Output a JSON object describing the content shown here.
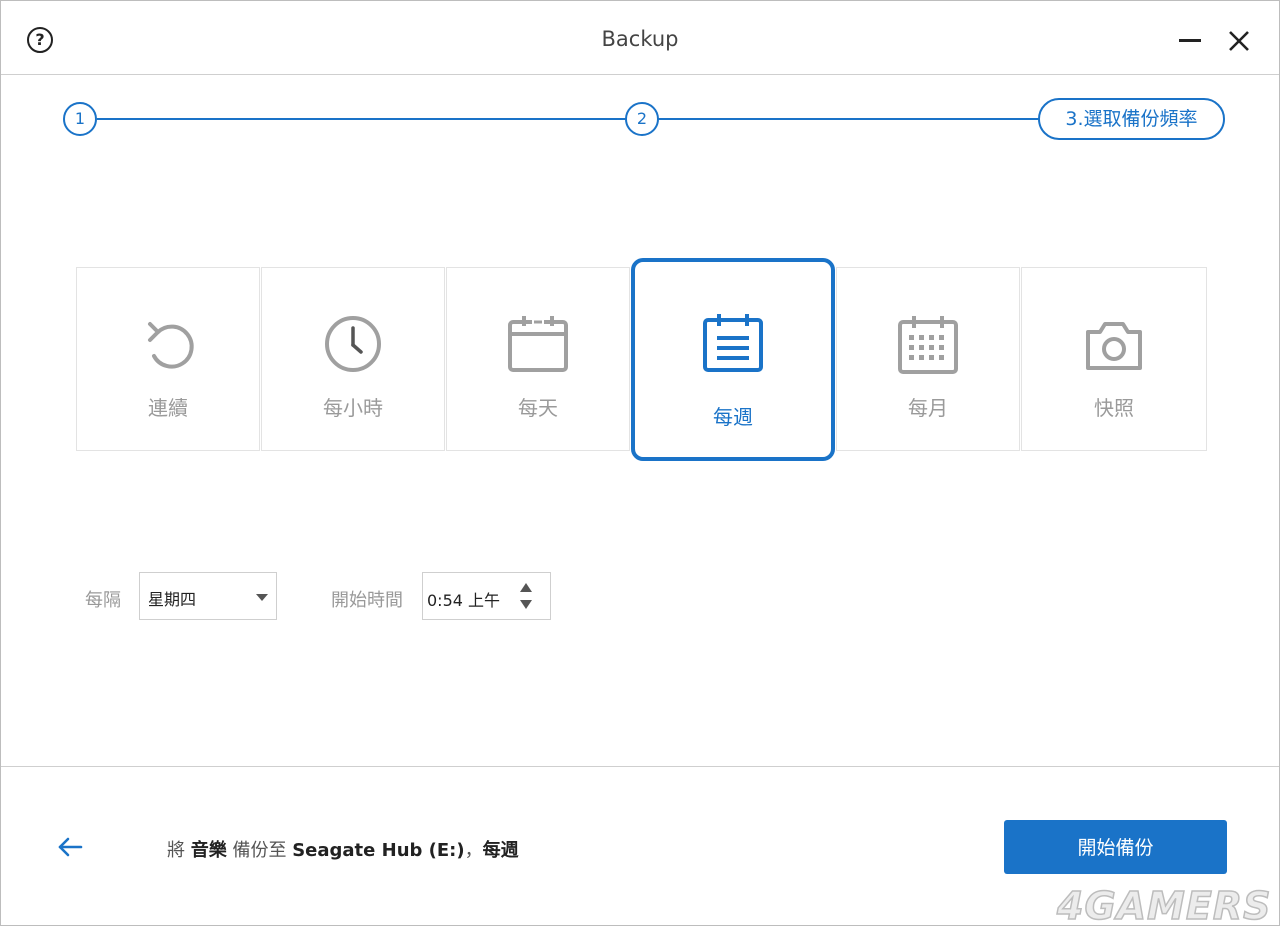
{
  "window": {
    "title": "Backup"
  },
  "stepper": {
    "step1": "1",
    "step2": "2",
    "step3": "3.選取備份頻率"
  },
  "frequencies": [
    {
      "label": "連續",
      "icon": "continuous-icon"
    },
    {
      "label": "每小時",
      "icon": "clock-icon"
    },
    {
      "label": "每天",
      "icon": "calendar-day-icon"
    },
    {
      "label": "每週",
      "icon": "calendar-week-icon",
      "selected": true
    },
    {
      "label": "每月",
      "icon": "calendar-month-icon"
    },
    {
      "label": "快照",
      "icon": "camera-icon"
    }
  ],
  "options": {
    "interval_label": "每隔",
    "weekday_value": "星期四",
    "start_time_label": "開始時間",
    "start_time_value": "0:54 上午"
  },
  "footer": {
    "summary_prefix": "將",
    "source": "音樂",
    "summary_middle": "備份至",
    "destination": "Seagate Hub  (E:)",
    "comma": "，",
    "frequency": "每週",
    "start_button": "開始備份"
  },
  "watermark": "4GAMERS",
  "colors": {
    "accent": "#1a73c8",
    "muted_icon": "#a0a0a0",
    "border": "#e3e3e3"
  }
}
